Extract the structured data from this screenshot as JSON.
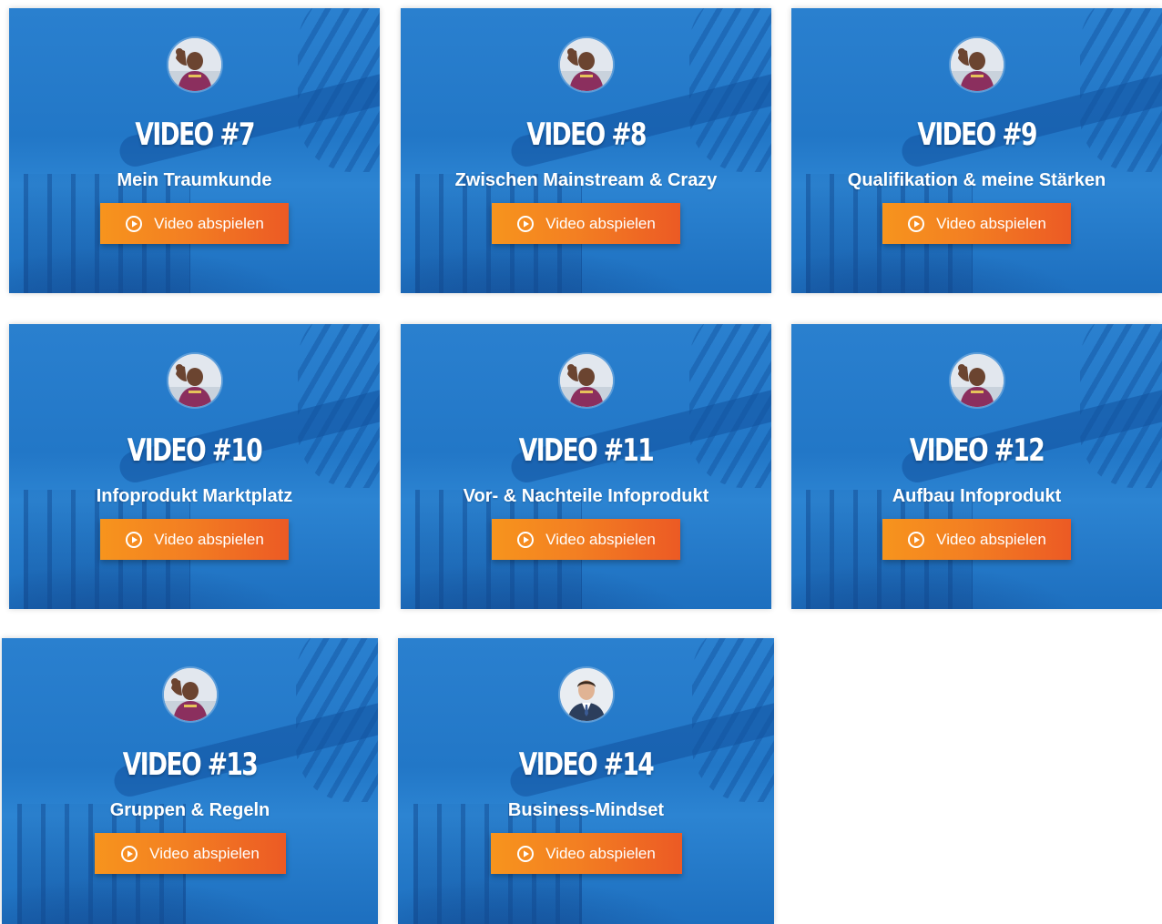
{
  "cards": [
    {
      "title": "VIDEO #7",
      "subtitle": "Mein Traumkunde",
      "button_label": "Video abspielen",
      "avatar": "man-in-purple-shirt"
    },
    {
      "title": "VIDEO #8",
      "subtitle": "Zwischen Mainstream & Crazy",
      "button_label": "Video abspielen",
      "avatar": "man-in-purple-shirt"
    },
    {
      "title": "VIDEO #9",
      "subtitle": "Qualifikation & meine Stärken",
      "button_label": "Video abspielen",
      "avatar": "man-in-purple-shirt"
    },
    {
      "title": "VIDEO #10",
      "subtitle": "Infoprodukt Marktplatz",
      "button_label": "Video abspielen",
      "avatar": "man-in-purple-shirt"
    },
    {
      "title": "VIDEO #11",
      "subtitle": "Vor- & Nachteile Infoprodukt",
      "button_label": "Video abspielen",
      "avatar": "man-in-purple-shirt"
    },
    {
      "title": "VIDEO #12",
      "subtitle": "Aufbau Infoprodukt",
      "button_label": "Video abspielen",
      "avatar": "man-in-purple-shirt"
    },
    {
      "title": "VIDEO #13",
      "subtitle": "Gruppen & Regeln",
      "button_label": "Video abspielen",
      "avatar": "man-in-purple-shirt"
    },
    {
      "title": "VIDEO #14",
      "subtitle": "Business-Mindset",
      "button_label": "Video abspielen",
      "avatar": "man-in-suit"
    }
  ],
  "colors": {
    "card_blue": "#1f77c8",
    "button_orange_start": "#f7941d",
    "button_orange_end": "#ec5a24",
    "text": "#ffffff"
  },
  "icons": {
    "play": "play-circle-icon"
  }
}
